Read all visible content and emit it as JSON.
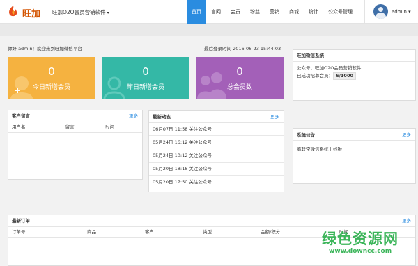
{
  "brand": {
    "logo_text": "旺加"
  },
  "app_switcher": {
    "label": "旺加O2O会员营销软件",
    "caret": "▾"
  },
  "nav": [
    {
      "label": "首页",
      "active": true
    },
    {
      "label": "官网",
      "active": false
    },
    {
      "label": "会员",
      "active": false
    },
    {
      "label": "粉丝",
      "active": false
    },
    {
      "label": "营销",
      "active": false
    },
    {
      "label": "商城",
      "active": false
    },
    {
      "label": "统计",
      "active": false
    },
    {
      "label": "公众号管理",
      "active": false
    }
  ],
  "user": {
    "name": "admin",
    "caret": "▾"
  },
  "welcome": "你好 admin！欢迎来到旺加微信平台",
  "last_login": "最后登录时间 2016-06-23 15:44:03",
  "stats": [
    {
      "value": "0",
      "label": "今日新增会员"
    },
    {
      "value": "0",
      "label": "昨日新增会员"
    },
    {
      "value": "0",
      "label": "总会员数"
    }
  ],
  "messages": {
    "title": "客户留言",
    "more": "更多",
    "columns": [
      "用户名",
      "留言",
      "时间"
    ]
  },
  "news": {
    "title": "最新动态",
    "more": "更多",
    "items": [
      "06月07日 11:58 关注公众号",
      "05月24日 16:12 关注公众号",
      "05月24日 10:12 关注公众号",
      "05月20日 18:18 关注公众号",
      "05月20日 17:50 关注公众号"
    ]
  },
  "wechat_system": {
    "title": "旺加微信系统",
    "account_line": "公众号：旺加O2O会员营销软件",
    "members_label": "已成功招募会员：",
    "members_value": "6/1000"
  },
  "notice": {
    "title": "系统公告",
    "more": "更多",
    "text": "商联宝微信系统上线啦"
  },
  "orders": {
    "title": "最新订单",
    "more": "更多",
    "columns": [
      "订单号",
      "商品",
      "客户",
      "类型",
      "金额/积分",
      "时间"
    ]
  },
  "watermark": {
    "big": "绿色资源网",
    "small": "www.downcc.com"
  },
  "colors": {
    "nav_active": "#2a8ce0",
    "stat_orange": "#f5b240",
    "stat_teal": "#34b8a6",
    "stat_purple": "#a360b8",
    "link": "#2a8ce0"
  }
}
